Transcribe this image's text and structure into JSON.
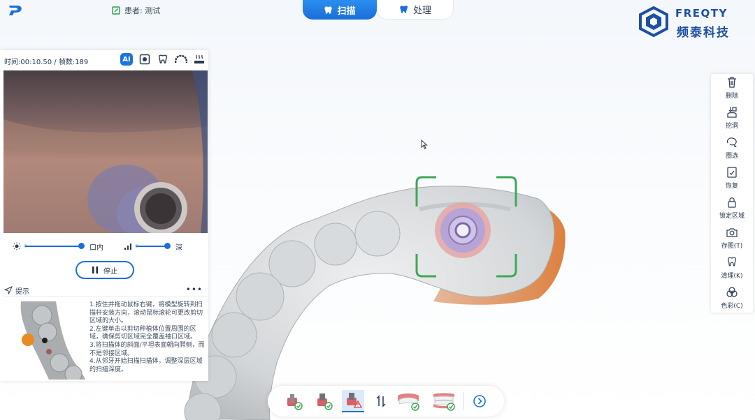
{
  "header": {
    "patient_label": "患者: 测试",
    "tabs": [
      {
        "label": "扫描",
        "active": true
      },
      {
        "label": "处理",
        "active": false
      }
    ],
    "brand_en": "FREQTY",
    "brand_cn": "频泰科技"
  },
  "scan_panel": {
    "status": "时间:00:10.50 / 帧数:189",
    "tool_icons": [
      "ai-icon",
      "focus-icon",
      "tooth-scan-icon",
      "arch-icon",
      "heat-icon"
    ],
    "ai_label": "AI",
    "brightness": {
      "label": "口内",
      "level": 1.0
    },
    "depth": {
      "label": "深",
      "level": 1.0
    },
    "stop_label": "停止"
  },
  "hint": {
    "title": "提示",
    "more": "•••",
    "lines": [
      "1.按住并拖动鼠标右键，将模型旋转到扫描杆安装方向，滚动鼠标滚轮可更改剪切区域的大小。",
      "2.左键单击以剪切种植体位置周围的区域，确保剪切区域完全覆盖袖口区域。",
      "3.将扫描体的斜面/平坦表面朝向腭侧，而不是邻接区域。",
      "4.从邻牙开始扫描扫描体，调整深层区域的扫描深度。"
    ]
  },
  "right_toolbar": [
    {
      "label": "删除",
      "icon": "trash-icon"
    },
    {
      "label": "挖洞",
      "icon": "dig-hole-icon"
    },
    {
      "label": "圈选",
      "icon": "lasso-select-icon"
    },
    {
      "label": "恢复",
      "icon": "restore-icon"
    },
    {
      "label": "锁定区域",
      "icon": "lock-icon"
    },
    {
      "label": "存图(T)",
      "icon": "camera-icon"
    },
    {
      "label": "清理(K)",
      "icon": "tooth-clean-icon"
    },
    {
      "label": "色彩(C)",
      "icon": "color-icon"
    }
  ],
  "bottom_toolbar": [
    {
      "icon": "implant-done-icon",
      "active": false
    },
    {
      "icon": "scanbody-done-icon",
      "active": false
    },
    {
      "icon": "scanbody-warning-icon",
      "active": true
    },
    {
      "icon": "swap-icon",
      "active": false
    },
    {
      "icon": "upper-jaw-done-icon",
      "active": false
    },
    {
      "icon": "lower-jaw-done-icon",
      "active": false
    },
    {
      "icon": "next-icon",
      "active": false
    }
  ],
  "colors": {
    "accent": "#1c6fd8",
    "focus_frame": "#3fa65a",
    "model": "#d7dadc",
    "scanbody": "#b7a4d6"
  }
}
